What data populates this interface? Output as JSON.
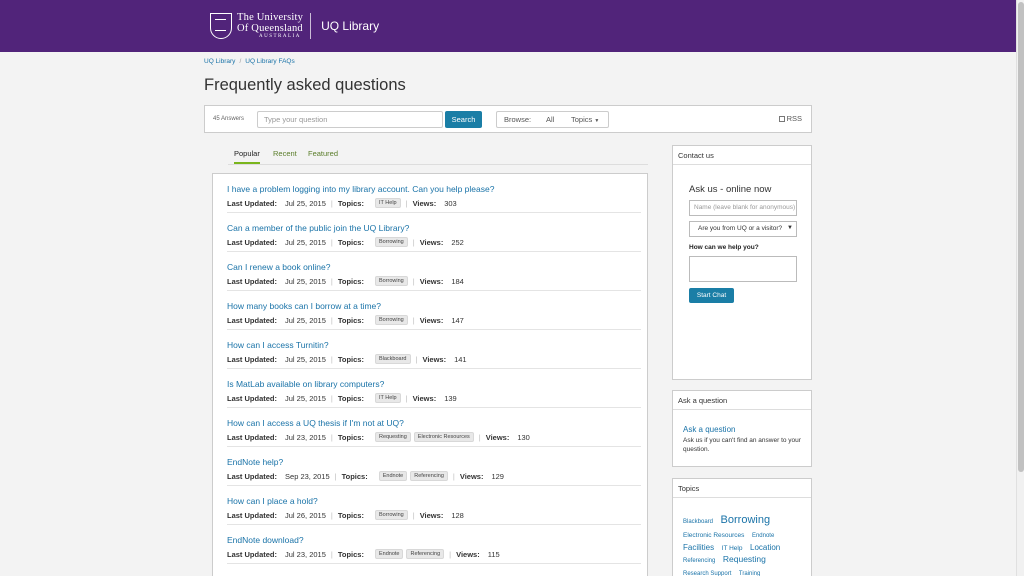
{
  "header": {
    "uni_line1": "The University",
    "uni_line2": "Of Queensland",
    "uni_line3": "AUSTRALIA",
    "library_name": "UQ Library"
  },
  "breadcrumb": [
    "UQ Library",
    "UQ Library FAQs"
  ],
  "page_title": "Frequently asked questions",
  "search": {
    "answers_count": "45 Answers",
    "placeholder": "Type your question",
    "button_label": "Search",
    "browse_label": "Browse:",
    "all_label": "All",
    "topics_label": "Topics",
    "rss_label": "RSS"
  },
  "tabs": [
    "Popular",
    "Recent",
    "Featured"
  ],
  "labels": {
    "last_updated": "Last Updated:",
    "topics": "Topics:",
    "views": "Views:"
  },
  "faqs": [
    {
      "question": "I have a problem logging into my library account. Can you help please?",
      "date": "Jul 25, 2015",
      "tags": [
        "IT Help"
      ],
      "views": "303"
    },
    {
      "question": "Can a member of the public join the UQ Library?",
      "date": "Jul 25, 2015",
      "tags": [
        "Borrowing"
      ],
      "views": "252"
    },
    {
      "question": "Can I renew a book online?",
      "date": "Jul 25, 2015",
      "tags": [
        "Borrowing"
      ],
      "views": "184"
    },
    {
      "question": "How many books can I borrow at a time?",
      "date": "Jul 25, 2015",
      "tags": [
        "Borrowing"
      ],
      "views": "147"
    },
    {
      "question": "How can I access Turnitin?",
      "date": "Jul 25, 2015",
      "tags": [
        "Blackboard"
      ],
      "views": "141"
    },
    {
      "question": "Is MatLab available on library computers?",
      "date": "Jul 25, 2015",
      "tags": [
        "IT Help"
      ],
      "views": "139"
    },
    {
      "question": "How can I access a UQ thesis if I'm not at UQ?",
      "date": "Jul 23, 2015",
      "tags": [
        "Requesting",
        "Electronic Resources"
      ],
      "views": "130"
    },
    {
      "question": "EndNote help?",
      "date": "Sep 23, 2015",
      "tags": [
        "Endnote",
        "Referencing"
      ],
      "views": "129"
    },
    {
      "question": "How can I place a hold?",
      "date": "Jul 26, 2015",
      "tags": [
        "Borrowing"
      ],
      "views": "128"
    },
    {
      "question": "EndNote download?",
      "date": "Jul 23, 2015",
      "tags": [
        "Endnote",
        "Referencing"
      ],
      "views": "115"
    }
  ],
  "contact": {
    "heading": "Contact us",
    "ask_title": "Ask us - online now",
    "name_placeholder": "Name (leave blank for anonymous)",
    "select_value": "Are you from UQ or a visitor?",
    "help_label": "How can we help you?",
    "chat_button": "Start Chat"
  },
  "ask_question": {
    "heading": "Ask a question",
    "link": "Ask a question",
    "description": "Ask us if you can't find an answer to your question."
  },
  "topics_panel": {
    "heading": "Topics",
    "cloud": [
      {
        "label": "Blackboard",
        "size": 6
      },
      {
        "label": "Borrowing",
        "size": 11
      },
      {
        "label": "Electronic Resources",
        "size": 6.5
      },
      {
        "label": "Endnote",
        "size": 6
      },
      {
        "label": "Facilities",
        "size": 8
      },
      {
        "label": "IT Help",
        "size": 6.5
      },
      {
        "label": "Location",
        "size": 8
      },
      {
        "label": "Referencing",
        "size": 6
      },
      {
        "label": "Requesting",
        "size": 8.5
      },
      {
        "label": "Research Support",
        "size": 6
      },
      {
        "label": "Training",
        "size": 6
      }
    ]
  }
}
